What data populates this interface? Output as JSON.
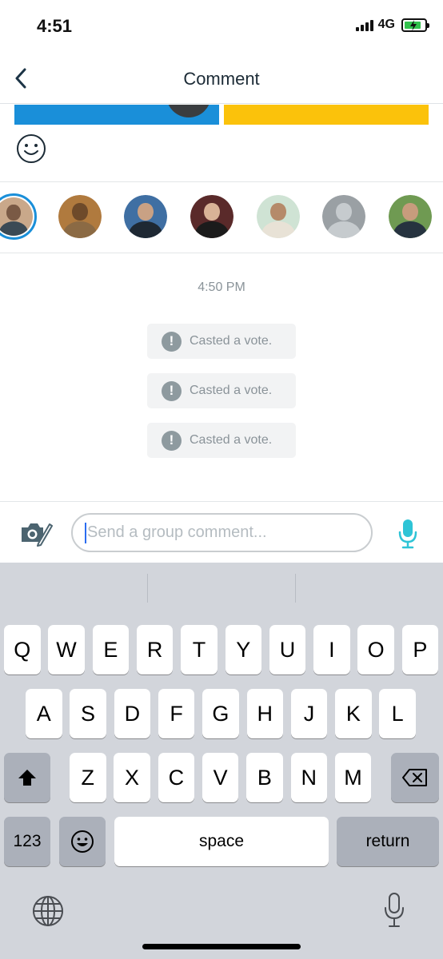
{
  "status_bar": {
    "time": "4:51",
    "network": "4G",
    "battery_level": 0.85,
    "battery_color": "#33c24d",
    "charging": true
  },
  "nav": {
    "title": "Comment",
    "back_icon": "chevron-left-icon"
  },
  "vote_bars": {
    "colors": [
      "#1a8fd9",
      "#fbc20b"
    ]
  },
  "emoji_icon": "smiley-icon",
  "avatars": [
    {
      "name": "avatar-1",
      "selected": true,
      "bg": "#c9a88a",
      "head": "#7a5a45",
      "body": "#3b4a55"
    },
    {
      "name": "avatar-2",
      "selected": false,
      "bg": "#b07a3e",
      "head": "#6e4a2a",
      "body": "#8b6a44"
    },
    {
      "name": "avatar-3",
      "selected": false,
      "bg": "#3f6fa3",
      "head": "#c9a184",
      "body": "#1e2833"
    },
    {
      "name": "avatar-4",
      "selected": false,
      "bg": "#5a2a2a",
      "head": "#d9b397",
      "body": "#1b1b1b"
    },
    {
      "name": "avatar-5",
      "selected": false,
      "bg": "#cfe3d4",
      "head": "#b58a6a",
      "body": "#e8e2d6"
    },
    {
      "name": "avatar-6",
      "selected": false,
      "bg": "#9aa0a4",
      "head": "#c6cbce",
      "body": "#c6cbce"
    },
    {
      "name": "avatar-7",
      "selected": false,
      "bg": "#6f9a52",
      "head": "#c79c7d",
      "body": "#26333f"
    }
  ],
  "chat": {
    "timestamp": "4:50 PM",
    "events": [
      {
        "text": "Casted a vote.",
        "icon": "alert-icon"
      },
      {
        "text": "Casted a vote.",
        "icon": "alert-icon"
      },
      {
        "text": "Casted a vote.",
        "icon": "alert-icon"
      }
    ]
  },
  "composer": {
    "placeholder": "Send a group comment...",
    "value": "",
    "camera_icon": "camera-edit-icon",
    "mic_icon": "microphone-icon",
    "mic_color": "#2ec4d6"
  },
  "keyboard": {
    "row1": [
      "Q",
      "W",
      "E",
      "R",
      "T",
      "Y",
      "U",
      "I",
      "O",
      "P"
    ],
    "row2": [
      "A",
      "S",
      "D",
      "F",
      "G",
      "H",
      "J",
      "K",
      "L"
    ],
    "row3": [
      "Z",
      "X",
      "C",
      "V",
      "B",
      "N",
      "M"
    ],
    "numbers_label": "123",
    "space_label": "space",
    "return_label": "return",
    "shift_icon": "shift-icon",
    "delete_icon": "backspace-icon",
    "emoji_icon": "emoji-keyboard-icon",
    "globe_icon": "globe-icon",
    "dictation_icon": "dictation-mic-icon"
  }
}
